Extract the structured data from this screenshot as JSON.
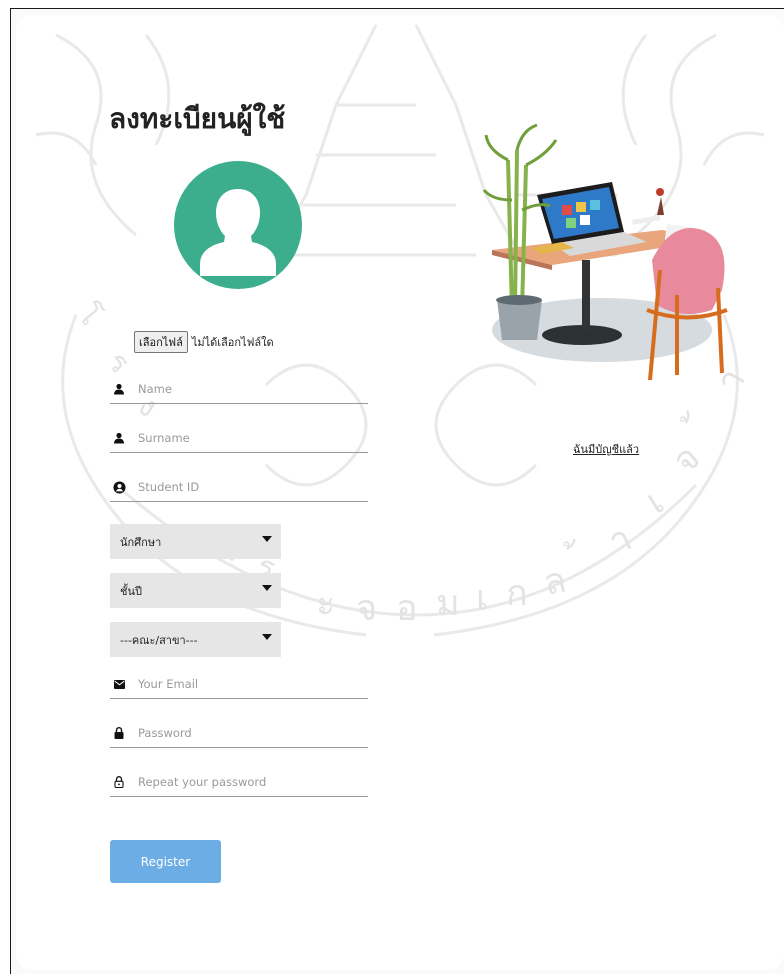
{
  "page": {
    "title": "ลงทะเบียนผู้ใช้",
    "login_link": "ฉันมีบัญชีแล้ว"
  },
  "file_input": {
    "button_label": "เลือกไฟล์",
    "status_text": "ไม่ได้เลือกไฟล์ใด"
  },
  "fields": {
    "name": {
      "placeholder": "Name",
      "icon": "person-icon"
    },
    "surname": {
      "placeholder": "Surname",
      "icon": "person-icon"
    },
    "student_id": {
      "placeholder": "Student ID",
      "icon": "user-circle-icon"
    },
    "email": {
      "placeholder": "Your Email",
      "icon": "envelope-icon"
    },
    "password": {
      "placeholder": "Password",
      "icon": "lock-icon"
    },
    "repeat_password": {
      "placeholder": "Repeat your password",
      "icon": "lock-outline-icon"
    }
  },
  "selects": {
    "role": {
      "selected": "นักศึกษา"
    },
    "year": {
      "selected": "ชั้นปี"
    },
    "faculty": {
      "selected": "---คณะ/สาขา---"
    }
  },
  "register_button": {
    "label": "Register"
  },
  "colors": {
    "avatar_bg": "#3dae8d",
    "button_bg": "#6dade6",
    "select_bg": "#e6e6e6"
  }
}
